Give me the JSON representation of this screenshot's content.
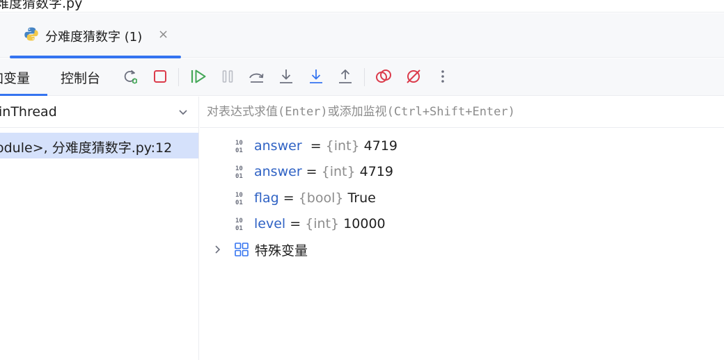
{
  "window": {
    "title_partial": "难度猜数字.py"
  },
  "session_tab": {
    "label": "分难度猜数字 (1)",
    "close_glyph": "×",
    "icon": "python-icon"
  },
  "toolbar": {
    "tabs": {
      "variables": "加变量",
      "console": "控制台"
    },
    "buttons": [
      "rerun-debug-icon",
      "stop-icon",
      "resume-icon",
      "pause-icon",
      "step-over-icon",
      "step-into-icon",
      "step-into-my-code-icon",
      "step-out-icon",
      "view-breakpoints-icon",
      "mute-breakpoints-icon",
      "more-icon"
    ]
  },
  "frames": {
    "thread": "inThread",
    "items": [
      "odule>, 分难度猜数字.py:12"
    ]
  },
  "evaluate": {
    "placeholder": "对表达式求值(Enter)或添加监视(Ctrl+Shift+Enter)"
  },
  "variables": [
    {
      "name": "answer",
      "eq": "  = ",
      "type": "{int}",
      "value": "4719"
    },
    {
      "name": "answer",
      "eq": " = ",
      "type": "{int}",
      "value": "4719"
    },
    {
      "name": "flag",
      "eq": " = ",
      "type": "{bool}",
      "value": "True"
    },
    {
      "name": "level",
      "eq": " = ",
      "type": "{int}",
      "value": "10000"
    }
  ],
  "special_variables": {
    "label": "特殊变量"
  },
  "colors": {
    "accent": "#3574f0",
    "variable_name": "#2f62c4",
    "type_hint": "#8c8c8c",
    "stop": "#db3b4b",
    "resume": "#45a858",
    "selection": "#d5e1fb"
  }
}
